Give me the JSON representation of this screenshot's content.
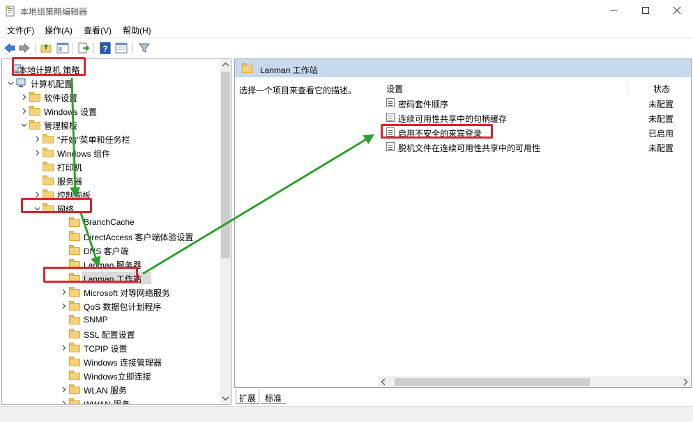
{
  "window": {
    "title": "本地组策略编辑器"
  },
  "menu": [
    "文件(F)",
    "操作(A)",
    "查看(V)",
    "帮助(H)"
  ],
  "toolbar": {
    "icons": [
      "back-icon",
      "forward-icon",
      "up-folder-icon",
      "show-hide-tree-icon",
      "export-list-icon",
      "help-icon",
      "properties-icon",
      "filter-icon"
    ]
  },
  "tree": {
    "nodes": [
      {
        "label": "本地计算机 策略",
        "expander": "none",
        "icon": "computer-policy-icon"
      },
      {
        "label": "计算机配置",
        "expander": "open",
        "icon": "computer-icon"
      },
      {
        "label": "软件设置",
        "expander": "closed",
        "icon": "folder-icon"
      },
      {
        "label": "Windows 设置",
        "expander": "closed",
        "icon": "folder-icon"
      },
      {
        "label": "管理模板",
        "expander": "open",
        "icon": "folder-icon"
      },
      {
        "label": "\"开始\"菜单和任务栏",
        "expander": "closed",
        "icon": "folder-icon"
      },
      {
        "label": "Windows 组件",
        "expander": "closed",
        "icon": "folder-icon"
      },
      {
        "label": "打印机",
        "expander": "none",
        "icon": "folder-icon"
      },
      {
        "label": "服务器",
        "expander": "none",
        "icon": "folder-icon"
      },
      {
        "label": "控制面板",
        "expander": "closed",
        "icon": "folder-icon"
      },
      {
        "label": "网络",
        "expander": "open",
        "icon": "folder-icon"
      },
      {
        "label": "BranchCache",
        "expander": "none",
        "icon": "folder-icon"
      },
      {
        "label": "DirectAccess 客户端体验设置",
        "expander": "none",
        "icon": "folder-icon"
      },
      {
        "label": "DNS 客户端",
        "expander": "none",
        "icon": "folder-icon"
      },
      {
        "label": "Lanman 服务器",
        "expander": "none",
        "icon": "folder-icon"
      },
      {
        "label": "Lanman 工作站",
        "expander": "none",
        "icon": "folder-open-icon",
        "selected": true
      },
      {
        "label": "Microsoft 对等网络服务",
        "expander": "closed",
        "icon": "folder-icon"
      },
      {
        "label": "QoS 数据包计划程序",
        "expander": "closed",
        "icon": "folder-icon"
      },
      {
        "label": "SNMP",
        "expander": "none",
        "icon": "folder-icon"
      },
      {
        "label": "SSL 配置设置",
        "expander": "none",
        "icon": "folder-icon"
      },
      {
        "label": "TCPIP 设置",
        "expander": "closed",
        "icon": "folder-icon"
      },
      {
        "label": "Windows 连接管理器",
        "expander": "none",
        "icon": "folder-icon"
      },
      {
        "label": "Windows立即连接",
        "expander": "none",
        "icon": "folder-icon"
      },
      {
        "label": "WLAN 服务",
        "expander": "closed",
        "icon": "folder-icon"
      },
      {
        "label": "WWAN 服务",
        "expander": "closed",
        "icon": "folder-icon"
      }
    ]
  },
  "right": {
    "header_title": "Lanman 工作站",
    "description": "选择一个项目来查看它的描述。",
    "col_setting": "设置",
    "col_state": "状态",
    "rows": [
      {
        "name": "密码套件顺序",
        "state": "未配置"
      },
      {
        "name": "连续可用性共享中的句柄缓存",
        "state": "未配置"
      },
      {
        "name": "启用不安全的来宾登录",
        "state": "已启用"
      },
      {
        "name": "脱机文件在连续可用性共享中的可用性",
        "state": "未配置"
      }
    ]
  },
  "tabs": [
    "扩展",
    "标准"
  ],
  "colors": {
    "highlight_red": "#d8252a",
    "arrow_green": "#2ca02c",
    "header_blue": "#c8d9ee",
    "folder_yellow": "#f3d27a"
  }
}
